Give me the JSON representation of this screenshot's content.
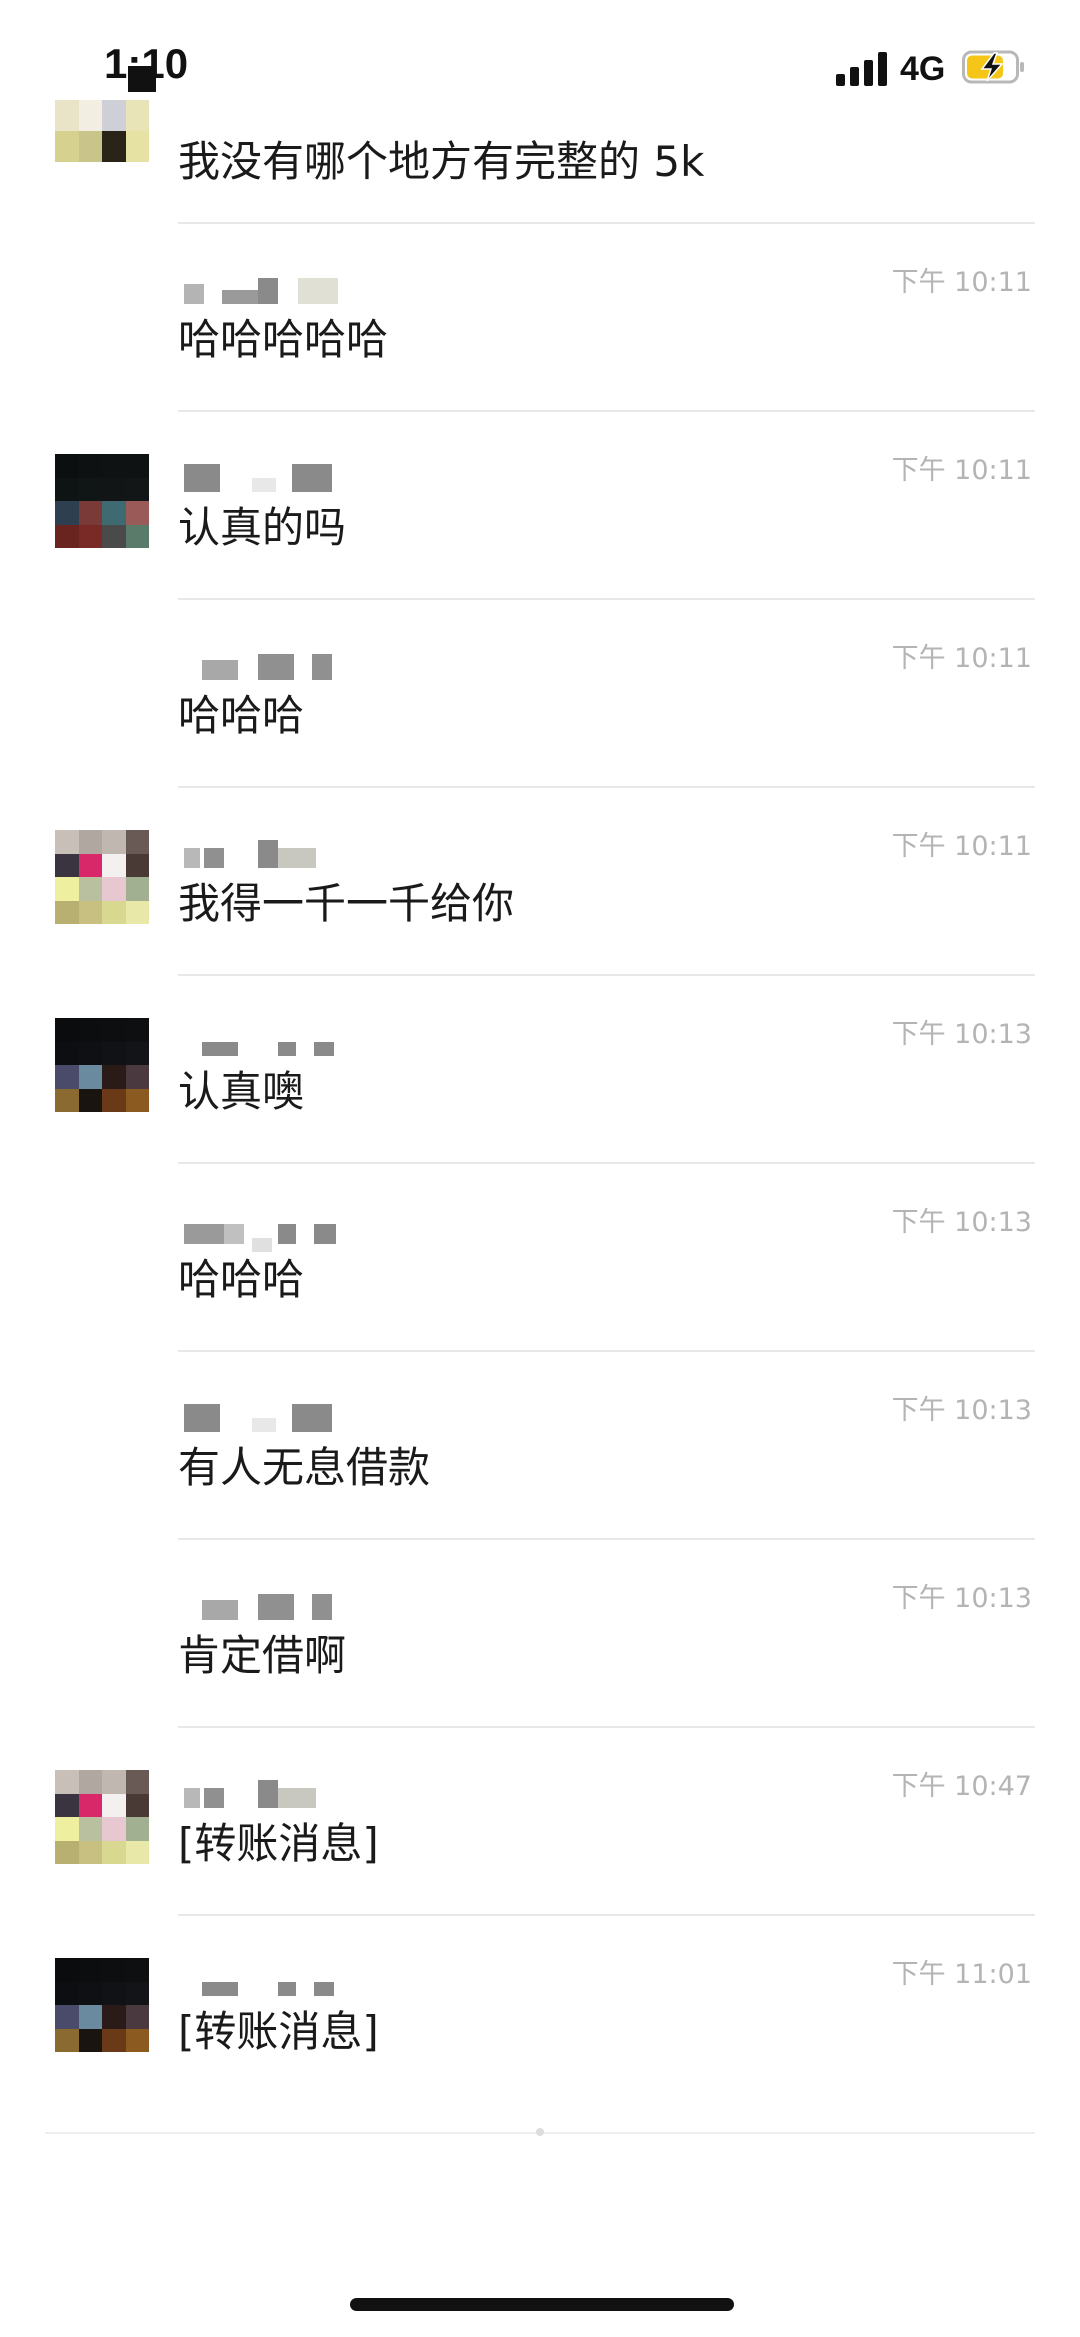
{
  "status_bar": {
    "time": "1:10",
    "network": "4G",
    "battery_icon": "battery-charging-icon",
    "signal_icon": "cellular-signal-icon",
    "battery_color": "#f5c518"
  },
  "messages": [
    {
      "time": "",
      "text": "我没有哪个地方有完整的 5k"
    },
    {
      "time": "下午 10:11",
      "text": "哈哈哈哈哈"
    },
    {
      "time": "下午 10:11",
      "text": "认真的吗"
    },
    {
      "time": "下午 10:11",
      "text": "哈哈哈"
    },
    {
      "time": "下午 10:11",
      "text": "我得一千一千给你"
    },
    {
      "time": "下午 10:13",
      "text": "认真噢"
    },
    {
      "time": "下午 10:13",
      "text": "哈哈哈"
    },
    {
      "time": "下午 10:13",
      "text": "有人无息借款"
    },
    {
      "time": "下午 10:13",
      "text": "肯定借啊"
    },
    {
      "time": "下午 10:47",
      "text": "[转账消息]"
    },
    {
      "time": "下午 11:01",
      "text": "[转账消息]"
    }
  ],
  "colors": {
    "text": "#1a1a1a",
    "timestamp": "#b4b4b4",
    "divider": "#e8e8e8",
    "redacted_name": "#8a8a8a"
  }
}
